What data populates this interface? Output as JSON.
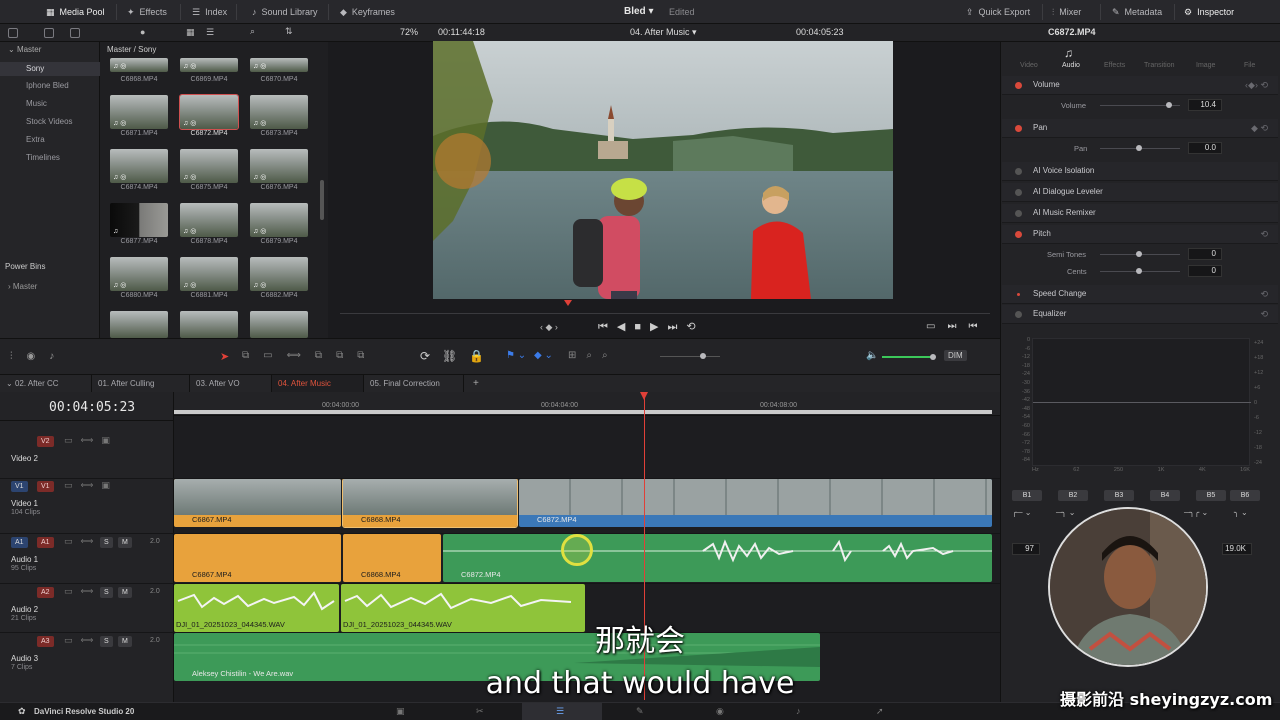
{
  "topbar": {
    "media_pool": "Media Pool",
    "effects": "Effects",
    "index": "Index",
    "sound_library": "Sound Library",
    "keyframes": "Keyframes",
    "project_name": "Bled",
    "project_status": "Edited",
    "quick_export": "Quick Export",
    "mixer": "Mixer",
    "metadata": "Metadata",
    "inspector": "Inspector"
  },
  "viewer_bar": {
    "zoom": "72%",
    "source_timecode": "00:11:44:18",
    "timeline_name": "04. After Music",
    "record_timecode": "00:04:05:23",
    "clip_name": "C6872.MP4"
  },
  "bins": {
    "header": "Master",
    "items": [
      "Sony",
      "Iphone Bled",
      "Music",
      "Stock Videos",
      "Extra",
      "Timelines"
    ],
    "selected": "Sony",
    "power_bins_header": "Power Bins",
    "power_bins_master": "Master"
  },
  "pool": {
    "breadcrumb": "Master / Sony",
    "clips": [
      "C6868.MP4",
      "C6869.MP4",
      "C6870.MP4",
      "C6871.MP4",
      "C6872.MP4",
      "C6873.MP4",
      "C6874.MP4",
      "C6875.MP4",
      "C6876.MP4",
      "C6877.MP4",
      "C6878.MP4",
      "C6879.MP4",
      "C6880.MP4",
      "C6881.MP4",
      "C6882.MP4"
    ],
    "selected_clip": "C6872.MP4"
  },
  "inspector": {
    "tabs": [
      "Video",
      "Audio",
      "Effects",
      "Transition",
      "Image",
      "File"
    ],
    "active_tab": "Audio",
    "volume_label": "Volume",
    "volume_sub": "Volume",
    "volume_value": "10.4",
    "pan_label": "Pan",
    "pan_sub": "Pan",
    "pan_value": "0.0",
    "ai_voice": "AI Voice Isolation",
    "ai_dialogue": "AI Dialogue Leveler",
    "ai_music": "AI Music Remixer",
    "pitch_label": "Pitch",
    "semitones_label": "Semi Tones",
    "semitones_value": "0",
    "cents_label": "Cents",
    "cents_value": "0",
    "speed_change": "Speed Change",
    "equalizer": "Equalizer",
    "eq_db_left": [
      "0",
      "-6",
      "-12",
      "-18",
      "-24",
      "-30",
      "-36",
      "-42",
      "-48",
      "-54",
      "-60",
      "-66",
      "-72",
      "-78",
      "-84"
    ],
    "eq_db_right": [
      "+24",
      "+18",
      "+12",
      "+6",
      "0",
      "-6",
      "-12",
      "-18",
      "-24"
    ],
    "eq_freq": [
      "Hz",
      "62",
      "250",
      "1K",
      "4K",
      "16K"
    ],
    "bands": [
      "B1",
      "B2",
      "B3",
      "B4",
      "B5",
      "B6"
    ],
    "band_left_value": "97",
    "band_right_value": "19.0K"
  },
  "timeline_tabs": [
    "02. After CC",
    "01. After Culling",
    "03. After VO",
    "04. After Music",
    "05. Final Correction"
  ],
  "active_timeline": "04. After Music",
  "timeline": {
    "timecode": "00:04:05:23",
    "ruler": [
      "00:04:00:00",
      "00:04:04:00",
      "00:04:08:00"
    ],
    "dim_label": "DIM",
    "tracks": [
      {
        "id": "V2",
        "name": "Video 2",
        "count": ""
      },
      {
        "id": "V1",
        "name": "Video 1",
        "count": "104 Clips"
      },
      {
        "id": "A1",
        "name": "Audio 1",
        "count": "95 Clips",
        "level": "2.0"
      },
      {
        "id": "A2",
        "name": "Audio 2",
        "count": "21 Clips",
        "level": "2.0"
      },
      {
        "id": "A3",
        "name": "Audio 3",
        "count": "7 Clips",
        "level": "2.0"
      }
    ],
    "v1_clips": [
      "C6867.MP4",
      "C6868.MP4",
      "C6872.MP4"
    ],
    "a1_clips": [
      "C6867.MP4",
      "C6868.MP4",
      "C6872.MP4"
    ],
    "a2_clips": [
      "DJI_01_20251023_044345.WAV",
      "DJI_01_20251023_044345.WAV"
    ],
    "a3_clips": [
      "Aleksey Chistilin - We Are.wav"
    ]
  },
  "bottom": {
    "app_name": "DaVinci Resolve Studio 20"
  },
  "subtitles": {
    "chinese": "那就会",
    "english": "and that would have"
  },
  "watermark": "摄影前沿 sheyingzyz.com",
  "colors": {
    "accent_red": "#e04038",
    "clip_orange": "#e8a23c",
    "clip_blue": "#3b78b8",
    "audio_green": "#3d9a58",
    "audio_lime": "#8fc43a"
  },
  "icons": [
    "media-pool-icon",
    "effects-icon",
    "index-icon",
    "sound-library-icon",
    "keyframes-icon",
    "quick-export-icon",
    "mixer-icon",
    "metadata-icon",
    "inspector-icon"
  ]
}
